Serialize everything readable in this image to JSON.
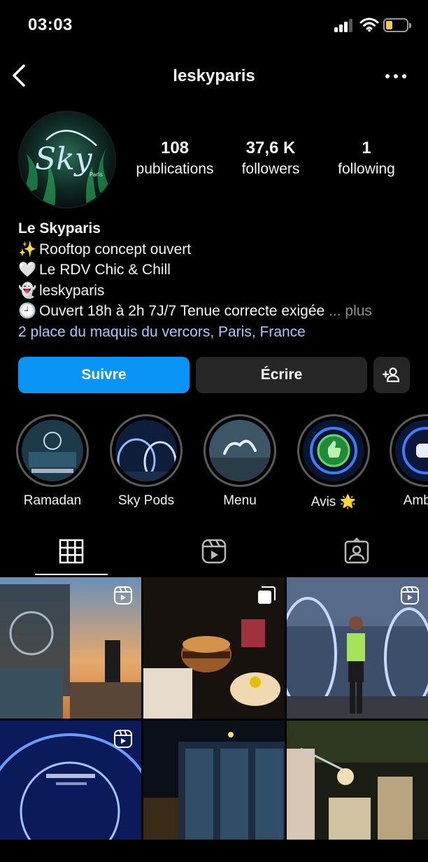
{
  "status_bar": {
    "time": "03:03"
  },
  "header": {
    "username": "leskyparis"
  },
  "profile": {
    "avatar": {
      "logo_text": "Sky",
      "logo_sub": "Paris"
    },
    "stats": [
      {
        "number": "108",
        "label": "publications"
      },
      {
        "number": "37,6 K",
        "label": "followers"
      },
      {
        "number": "1",
        "label": "following"
      }
    ],
    "name": "Le Skyparis",
    "bio_lines": [
      {
        "emoji": "✨",
        "text": "Rooftop concept ouvert"
      },
      {
        "emoji": "🤍",
        "text": "Le RDV Chic & Chill"
      },
      {
        "emoji": "👻",
        "text": "leskyparis"
      },
      {
        "emoji": "🕘",
        "text": "Ouvert 18h à 2h 7J/7 Tenue correcte exigée"
      }
    ],
    "more_label": "... plus",
    "address": "2 place du maquis du vercors, Paris, France"
  },
  "actions": {
    "follow_label": "Suivre",
    "write_label": "Écrire"
  },
  "highlights": [
    {
      "label": "Ramadan"
    },
    {
      "label": "Sky Pods"
    },
    {
      "label": "Menu"
    },
    {
      "label": "Avis 🌟"
    },
    {
      "label": "Ambian"
    }
  ],
  "tabs": [
    {
      "name": "grid",
      "icon": "grid-icon",
      "active": true
    },
    {
      "name": "reels",
      "icon": "reels-icon",
      "active": false
    },
    {
      "name": "tagged",
      "icon": "tagged-icon",
      "active": false
    }
  ],
  "grid_posts": [
    {
      "type": "reel"
    },
    {
      "type": "carousel"
    },
    {
      "type": "reel"
    },
    {
      "type": "reel"
    },
    {
      "type": "image"
    },
    {
      "type": "image"
    }
  ],
  "colors": {
    "accent": "#0a95f6",
    "link": "#a8c8ff",
    "background": "#000000",
    "button_dark": "#262626"
  }
}
